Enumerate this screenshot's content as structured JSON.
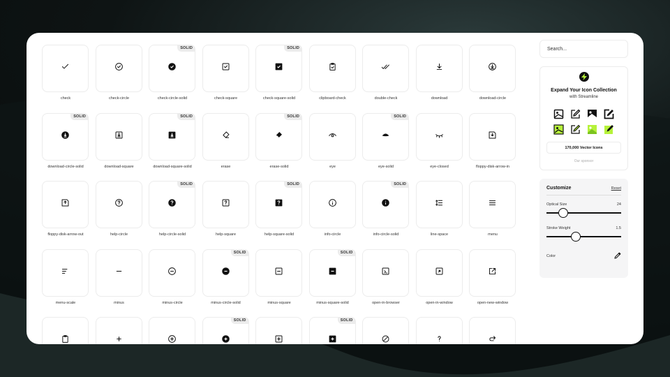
{
  "icons": [
    {
      "label": "check",
      "solid": false
    },
    {
      "label": "check-circle",
      "solid": false
    },
    {
      "label": "check-circle-solid",
      "solid": true
    },
    {
      "label": "check-square",
      "solid": false
    },
    {
      "label": "check-square-solid",
      "solid": true
    },
    {
      "label": "clipboard-check",
      "solid": false
    },
    {
      "label": "double-check",
      "solid": false
    },
    {
      "label": "download",
      "solid": false
    },
    {
      "label": "download-circle",
      "solid": false
    },
    {
      "label": "download-circle-solid",
      "solid": true
    },
    {
      "label": "download-square",
      "solid": false
    },
    {
      "label": "download-square-solid",
      "solid": true
    },
    {
      "label": "erase",
      "solid": false
    },
    {
      "label": "erase-solid",
      "solid": true
    },
    {
      "label": "eye",
      "solid": false
    },
    {
      "label": "eye-solid",
      "solid": true
    },
    {
      "label": "eye-closed",
      "solid": false
    },
    {
      "label": "floppy-disk-arrow-in",
      "solid": false
    },
    {
      "label": "floppy-disk-arrow-out",
      "solid": false
    },
    {
      "label": "help-circle",
      "solid": false
    },
    {
      "label": "help-circle-solid",
      "solid": true
    },
    {
      "label": "help-square",
      "solid": false
    },
    {
      "label": "help-square-solid",
      "solid": true
    },
    {
      "label": "info-circle",
      "solid": false
    },
    {
      "label": "info-circle-solid",
      "solid": true
    },
    {
      "label": "line-space",
      "solid": false
    },
    {
      "label": "menu",
      "solid": false
    },
    {
      "label": "menu-scale",
      "solid": false
    },
    {
      "label": "minus",
      "solid": false
    },
    {
      "label": "minus-circle",
      "solid": false
    },
    {
      "label": "minus-circle-solid",
      "solid": true
    },
    {
      "label": "minus-square",
      "solid": false
    },
    {
      "label": "minus-square-solid",
      "solid": true
    },
    {
      "label": "open-in-browser",
      "solid": false
    },
    {
      "label": "open-in-window",
      "solid": false
    },
    {
      "label": "open-new-window",
      "solid": false
    },
    {
      "label": "",
      "solid": false
    },
    {
      "label": "",
      "solid": false
    },
    {
      "label": "",
      "solid": false
    },
    {
      "label": "",
      "solid": true
    },
    {
      "label": "",
      "solid": false
    },
    {
      "label": "",
      "solid": true
    },
    {
      "label": "",
      "solid": false
    },
    {
      "label": "",
      "solid": false
    },
    {
      "label": "",
      "solid": false
    }
  ],
  "icon_names": [
    "check-icon",
    "check-circle-icon",
    "check-circle-solid-icon",
    "check-square-icon",
    "check-square-solid-icon",
    "clipboard-check-icon",
    "double-check-icon",
    "download-icon",
    "download-circle-icon",
    "download-circle-solid-icon",
    "download-square-icon",
    "download-square-solid-icon",
    "erase-icon",
    "erase-solid-icon",
    "eye-icon",
    "eye-solid-icon",
    "eye-closed-icon",
    "floppy-disk-arrow-in-icon",
    "floppy-disk-arrow-out-icon",
    "help-circle-icon",
    "help-circle-solid-icon",
    "help-square-icon",
    "help-square-solid-icon",
    "info-circle-icon",
    "info-circle-solid-icon",
    "line-space-icon",
    "menu-icon",
    "menu-scale-icon",
    "minus-icon",
    "minus-circle-icon",
    "minus-circle-solid-icon",
    "minus-square-icon",
    "minus-square-solid-icon",
    "open-in-browser-icon",
    "open-in-window-icon",
    "open-new-window-icon",
    "clipboard-icon",
    "plus-icon",
    "plus-circle-icon",
    "plus-circle-solid-icon",
    "plus-square-icon",
    "plus-square-solid-icon",
    "prohibition-icon",
    "question-mark-icon",
    "redo-icon"
  ],
  "solid_badge": "SOLID",
  "search": {
    "placeholder": "Search..."
  },
  "promo": {
    "title": "Expand Your Icon Collection",
    "subtitle": "with Streamline",
    "button": "170,000 Vector Icons",
    "sponsor": "Our sponsor",
    "icons": [
      "image-frame-icon",
      "edit-icon",
      "image-icon",
      "edit-solid-icon",
      "image-frame-green-icon",
      "edit-green-icon",
      "image-green-icon",
      "edit-green-solid-icon"
    ]
  },
  "customize": {
    "title": "Customize",
    "reset": "Reset",
    "optical_size_label": "Optical Size",
    "optical_size_value": "24",
    "optical_size_level": 0.18,
    "stroke_weight_label": "Stroke Weight",
    "stroke_weight_value": "1.5",
    "stroke_weight_level": 0.38,
    "color_label": "Color"
  },
  "colors": {
    "accent": "#b6f23a",
    "text": "#111111",
    "border": "#ececec"
  }
}
